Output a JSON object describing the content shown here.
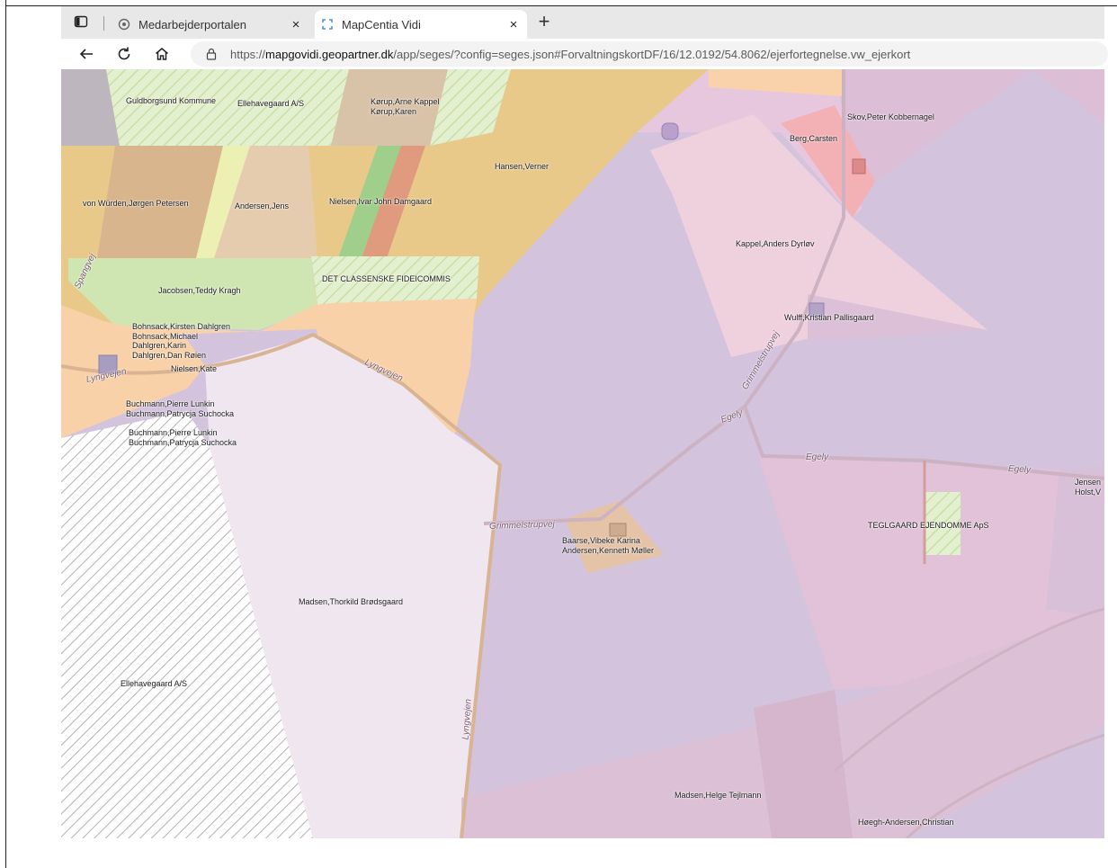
{
  "browser": {
    "tabs": [
      {
        "title": "Medarbejderportalen",
        "active": false,
        "close": "×"
      },
      {
        "title": "MapCentia Vidi",
        "active": true,
        "close": "×"
      }
    ],
    "new_tab": "+",
    "url": {
      "scheme": "https://",
      "host": "mapgovidi.geopartner.dk",
      "path": "/app/seges/?config=seges.json#ForvaltningskortDF/16/12.0192/54.8062/ejerfortegnelse.vw_ejerkort"
    }
  },
  "map": {
    "owner_labels": [
      {
        "text": "Guldborgsund Kommune"
      },
      {
        "text": "Ellehavegaard A/S"
      },
      {
        "text": "Kørup,Arne Kappel\nKørup,Karen"
      },
      {
        "text": "Skov,Peter Kobbernagel"
      },
      {
        "text": "Berg,Carsten"
      },
      {
        "text": "Hansen,Verner"
      },
      {
        "text": "von Würden,Jørgen Petersen"
      },
      {
        "text": "Andersen,Jens"
      },
      {
        "text": "Nielsen,Ivar John Damgaard"
      },
      {
        "text": "Kappel,Anders Dyrløv"
      },
      {
        "text": "Jacobsen,Teddy Kragh"
      },
      {
        "text": "DET CLASSENSKE FIDEICOMMIS"
      },
      {
        "text": "Wulff,Kristian Pallisgaard"
      },
      {
        "text": "Bohnsack,Kirsten Dahlgren\nBohnsack,Michael\nDahlgren,Karin\nDahlgren,Dan Røien"
      },
      {
        "text": "Nielsen,Kate"
      },
      {
        "text": "Buchmann,Pierre Lunkin\nBuchmann,Patrycja Suchocka"
      },
      {
        "text": "Buchmann,Pierre Lunkin\nBuchmann,Patrycja Suchocka"
      },
      {
        "text": "Jensen\nHolst,V"
      },
      {
        "text": "TEGLGAARD EJENDOMME ApS"
      },
      {
        "text": "Baarse,Vibeke Karina\nAndersen,Kenneth Møller"
      },
      {
        "text": "Madsen,Thorkild Brødsgaard"
      },
      {
        "text": "Ellehavegaard A/S"
      },
      {
        "text": "Madsen,Helge Tejlmann"
      },
      {
        "text": "Høegh-Andersen,Christian"
      }
    ],
    "road_labels": [
      {
        "text": "Spangvej"
      },
      {
        "text": "Lyngvejen"
      },
      {
        "text": "Lyngvejen"
      },
      {
        "text": "Grimmelstrupvej"
      },
      {
        "text": "Egely"
      },
      {
        "text": "Egely"
      },
      {
        "text": "Egely"
      },
      {
        "text": "Grimmelstrupvej"
      },
      {
        "text": "Lyngvejen"
      }
    ]
  }
}
